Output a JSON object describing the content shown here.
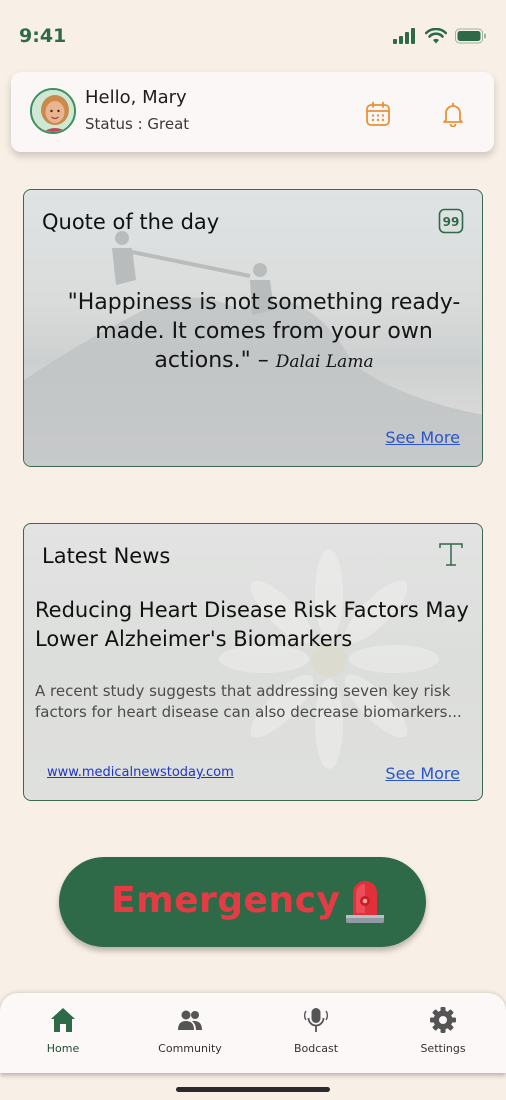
{
  "status_bar": {
    "time": "9:41",
    "icons": [
      "cellular-signal-icon",
      "wifi-icon",
      "battery-icon"
    ],
    "color": "#2f6a48"
  },
  "header": {
    "greeting": "Hello, Mary",
    "status": "Status : Great",
    "icons": [
      "calendar-icon",
      "bell-icon"
    ],
    "icon_color": "#e8913a"
  },
  "quote_card": {
    "title": "Quote of the day",
    "icon": "quote-icon",
    "quote": "\"Happiness is not something ready-made. It comes from your own actions.\" –",
    "author": "Dalai Lama",
    "see_more": "See More"
  },
  "news_card": {
    "title": "Latest News",
    "icon": "text-icon",
    "headline": "Reducing Heart Disease Risk Factors May Lower Alzheimer's Biomarkers",
    "summary_line1": "A recent study suggests that addressing seven key risk",
    "summary_line2": "factors for heart disease can also decrease biomarkers...",
    "source": "www.medicalnewstoday.com",
    "see_more": "See More"
  },
  "emergency": {
    "label": "Emergency",
    "icon": "siren-icon",
    "bg_color": "#2f6a48",
    "text_color": "#e53b45"
  },
  "bottom_nav": {
    "items": [
      {
        "label": "Home",
        "icon": "home-icon",
        "active": true
      },
      {
        "label": "Community",
        "icon": "community-icon",
        "active": false
      },
      {
        "label": "Bodcast",
        "icon": "microphone-icon",
        "active": false
      },
      {
        "label": "Settings",
        "icon": "gear-icon",
        "active": false
      }
    ]
  },
  "colors": {
    "background": "#f8efe6",
    "accent_green": "#2f6a48",
    "link_blue": "#2a55c8"
  }
}
